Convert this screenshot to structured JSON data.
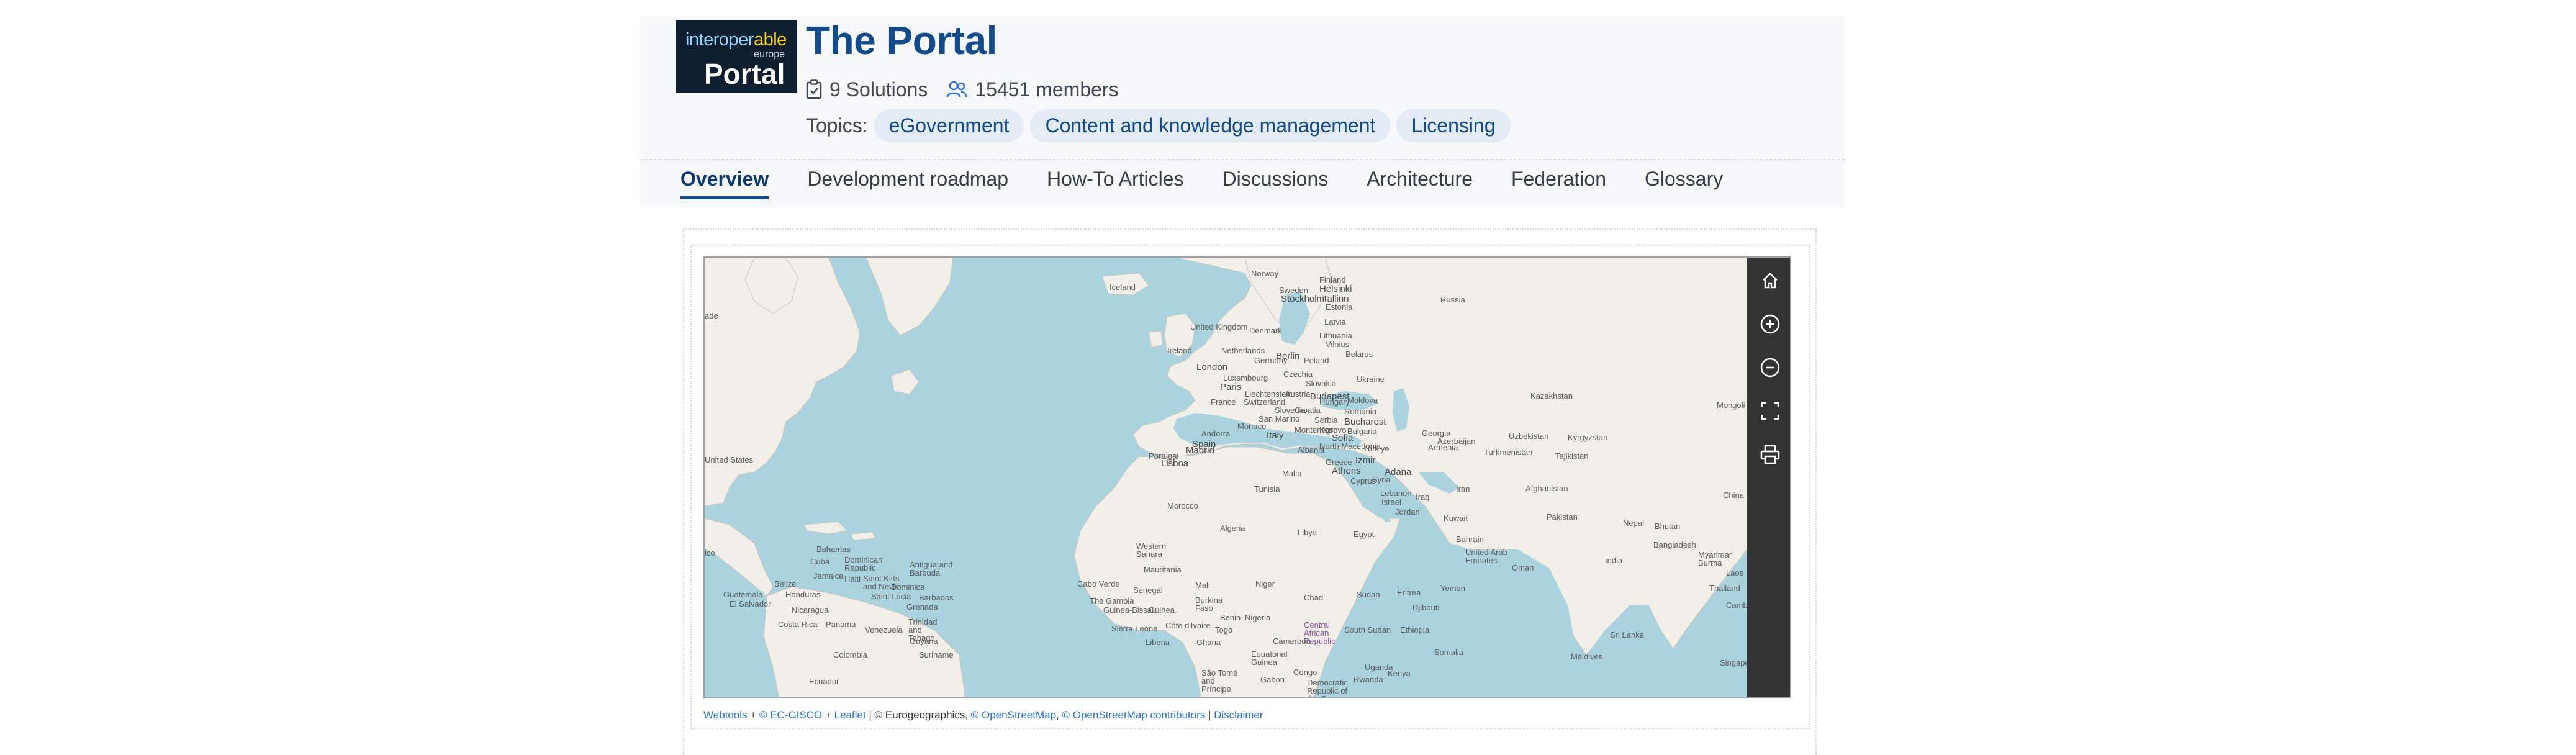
{
  "logo": {
    "line1a": "interoper",
    "line1b": "able",
    "line2": "europe",
    "line3": "Portal"
  },
  "header": {
    "title": "The Portal",
    "solutions": "9 Solutions",
    "members": "15451 members",
    "topics_label": "Topics:",
    "topics": [
      "eGovernment",
      "Content and knowledge management",
      "Licensing"
    ]
  },
  "tabs": [
    {
      "label": "Overview",
      "active": true
    },
    {
      "label": "Development roadmap"
    },
    {
      "label": "How-To Articles"
    },
    {
      "label": "Discussions"
    },
    {
      "label": "Architecture"
    },
    {
      "label": "Federation"
    },
    {
      "label": "Glossary"
    }
  ],
  "map": {
    "water_color": "#aad3df",
    "land_color": "#f2efe9",
    "toolbar": [
      "home-icon",
      "zoom-in-icon",
      "zoom-out-icon",
      "fullscreen-icon",
      "print-icon"
    ],
    "labels": {
      "russia": "Russia",
      "kazakhstan": "Kazakhstan",
      "mongolia": "Mongoli",
      "uzbekistan": "Uzbekistan",
      "kyrgyzstan": "Kyrgyzstan",
      "turkmenistan": "Turkmenistan",
      "tajikistan": "Tajikistan",
      "afghanistan": "Afghanistan",
      "pakistan": "Pakistan",
      "nepal": "Nepal",
      "bhutan": "Bhutan",
      "china": "China",
      "india": "India",
      "bangladesh": "Bangladesh",
      "myanmar": "Myanmar Burma",
      "thailand": "Thailand",
      "laos": "Laos",
      "srilanka": "Sri Lanka",
      "maldives": "Maldives",
      "singapore": "Singapo",
      "cambodia": "Camb",
      "iran": "Iran",
      "iraq": "Iraq",
      "syria": "Syria",
      "lebanon": "Lebanon",
      "israel": "Israel",
      "jordan": "Jordan",
      "kuwait": "Kuwait",
      "bahrain": "Bahrain",
      "uae": "United Arab Emirates",
      "oman": "Oman",
      "yemen": "Yemen",
      "cyprus": "Cyprus",
      "georgia": "Georgia",
      "armenia": "Armenia",
      "azerbaijan": "Azerbaijan",
      "egypt": "Egypt",
      "libya": "Libya",
      "algeria": "Algeria",
      "tunisia": "Tunisia",
      "morocco": "Morocco",
      "westernsahara": "Western Sahara",
      "mauritania": "Mauritania",
      "mali": "Mali",
      "niger": "Niger",
      "chad": "Chad",
      "sudan": "Sudan",
      "eritrea": "Eritrea",
      "djibouti": "Djibouti",
      "ethiopia": "Ethiopia",
      "somalia": "Somalia",
      "southsudan": "South Sudan",
      "car": "Central African Republic",
      "nigeria": "Nigeria",
      "cameroon": "Cameroon",
      "senegal": "Senegal",
      "gambia": "The Gambia",
      "guinea": "Guinea",
      "guineabissau": "Guinea-Bissau",
      "sierraleone": "Sierra Leone",
      "liberia": "Liberia",
      "cotedivoire": "Côte d'Ivoire",
      "ghana": "Ghana",
      "togo": "Togo",
      "benin": "Benin",
      "burkina": "Burkina Faso",
      "capeverde": "Cabo Verde",
      "eqguinea": "Equatorial Guinea",
      "gabon": "Gabon",
      "congo": "Congo",
      "drc": "Democratic Republic of the Congo",
      "uganda": "Uganda",
      "kenya": "Kenya",
      "rwanda": "Rwanda",
      "saotome": "São Tomé and Príncipe",
      "iceland": "Iceland",
      "norway": "Norway",
      "sweden": "Sweden",
      "finland": "Finland",
      "helsinki": "Helsinki",
      "tallinn": "Tallinn",
      "stockholm": "Stockholm",
      "estonia": "Estonia",
      "latvia": "Latvia",
      "lithuania": "Lithuania",
      "vilnius": "Vilnius",
      "denmark": "Denmark",
      "uk": "United Kingdom",
      "ireland": "Ireland",
      "london": "London",
      "netherlands": "Netherlands",
      "berlin": "Berlin",
      "germany": "Germany",
      "poland": "Poland",
      "belarus": "Belarus",
      "ukraine": "Ukraine",
      "paris": "Paris",
      "france": "France",
      "luxembourg": "Luxembourg",
      "czechia": "Czechia",
      "slovakia": "Slovakia",
      "austria": "Austria",
      "hungary": "Hungary",
      "moldova": "Moldova",
      "romania": "Romania",
      "switzerland": "Switzerland",
      "liechtenstein": "Liechtenstein",
      "slovenia": "Slovenia",
      "croatia": "Croatia",
      "serbia": "Serbia",
      "bucharest": "Bucharest",
      "budapest": "Budapest",
      "italy": "Italy",
      "monaco": "Monaco",
      "sanmarino": "San Marino",
      "montenegro": "Montenegro",
      "albania": "Albania",
      "kosovo": "Kosovo",
      "northmacedonia": "North Macedonia",
      "bulgaria": "Bulgaria",
      "sofia": "Sofia",
      "greece": "Greece",
      "turkiye": "Türkiye",
      "izmir": "Izmir",
      "adana": "Adana",
      "malta": "Malta",
      "spain": "Spain",
      "andorra": "Andorra",
      "portugal": "Portugal",
      "lisbon": "Lisboa",
      "madrid": "Madrid",
      "athens": "Athens",
      "bahamas": "Bahamas",
      "cuba": "Cuba",
      "dominicanrep": "Dominican Republic",
      "haiti": "Haiti",
      "jamaica": "Jamaica",
      "belize": "Belize",
      "honduras": "Honduras",
      "guatemala": "Guatemala",
      "elsalvador": "El Salvador",
      "nicaragua": "Nicaragua",
      "costarica": "Costa Rica",
      "panama": "Panama",
      "venezuela": "Venezuela",
      "colombia": "Colombia",
      "ecuador": "Ecuador",
      "guyana": "Guyana",
      "suriname": "Suriname",
      "trinidad": "Trinidad and Tobago",
      "antigua": "Antigua and Barbuda",
      "dominica": "Dominica",
      "stlucia": "Saint Lucia",
      "barbados": "Barbados",
      "grenada": "Grenada",
      "stkitts": "Saint Kitts and Nevis",
      "unitedstates": "United States",
      "canada": "ade",
      "mexico": "ico"
    }
  },
  "attribution": {
    "webtools": "Webtools",
    "sep1": " + ",
    "ecgisco": "© EC-GISCO",
    "sep2": " + ",
    "leaflet": "Leaflet",
    "mid": " | © Eurogeographics, ",
    "osm": "© OpenStreetMap",
    "comma": ", ",
    "osmc": "© OpenStreetMap contributors",
    "pipe": " | ",
    "disclaimer": "Disclaimer"
  }
}
